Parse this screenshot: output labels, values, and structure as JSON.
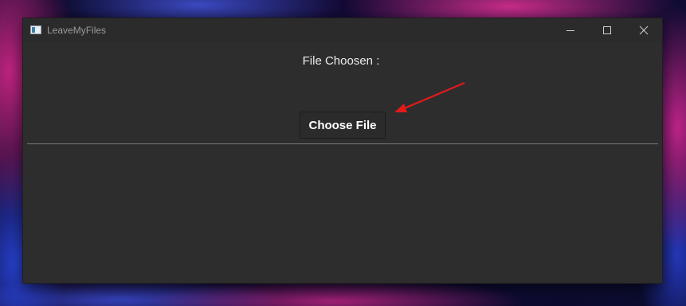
{
  "window": {
    "title": "LeaveMyFiles",
    "controls": {
      "minimize_icon": "minimize-icon",
      "maximize_icon": "maximize-icon",
      "close_icon": "close-icon"
    }
  },
  "main": {
    "file_label": "File Choosen :",
    "choose_button_label": "Choose File"
  },
  "annotation": {
    "arrow_color": "#e21a1a"
  },
  "colors": {
    "window_bg": "#2d2d2d",
    "text": "#ececec",
    "title_text": "#9b9b9b",
    "divider": "#7a7a7a"
  }
}
